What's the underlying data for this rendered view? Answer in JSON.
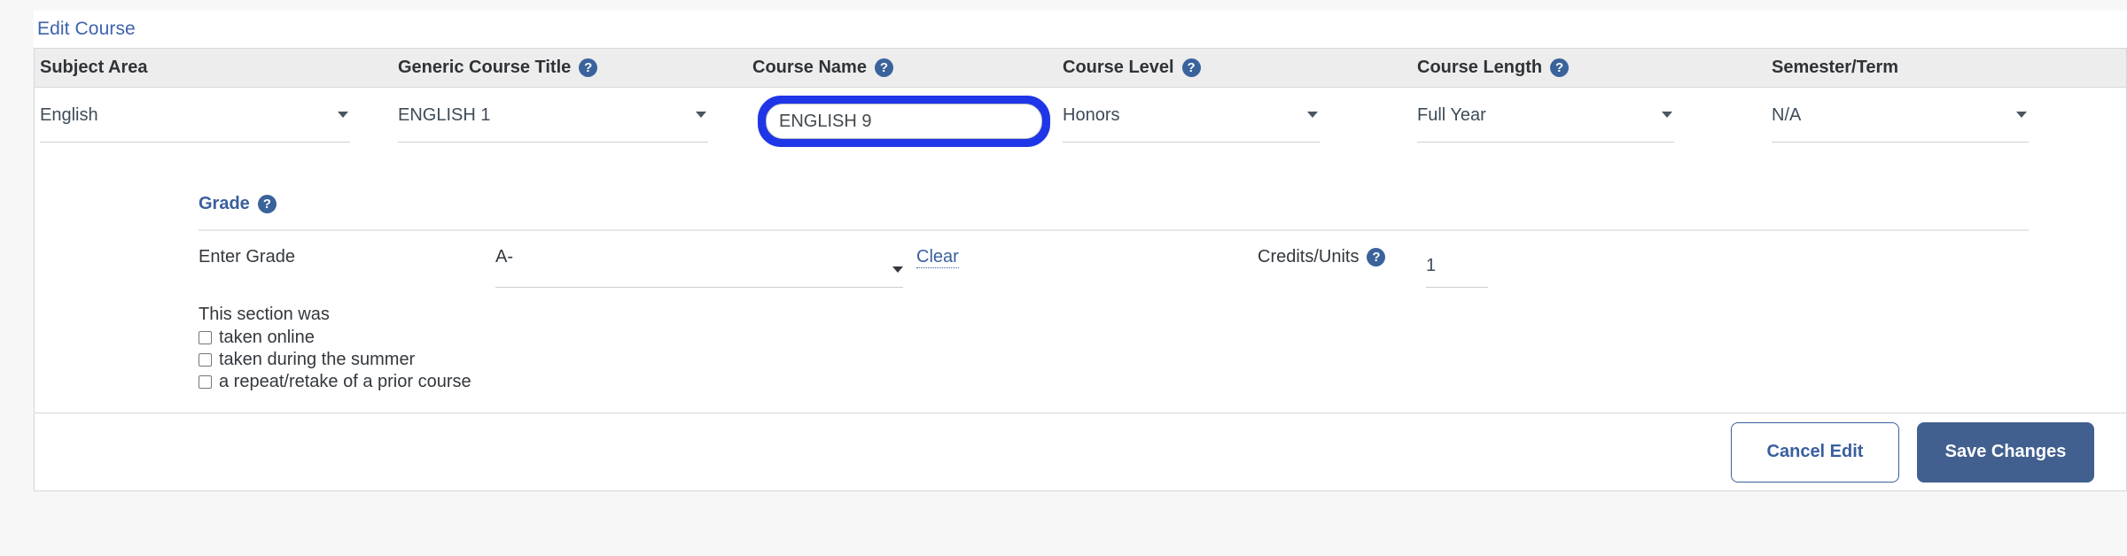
{
  "panel": {
    "title": "Edit Course",
    "help_icon": "help-circle-icon",
    "caret_icon": "chevron-down-icon"
  },
  "columns": [
    {
      "header": "Subject Area",
      "has_help": false,
      "value": "English",
      "type": "select"
    },
    {
      "header": "Generic Course Title",
      "has_help": true,
      "value": "ENGLISH 1",
      "type": "select"
    },
    {
      "header": "Course Name",
      "has_help": true,
      "value": "ENGLISH 9",
      "type": "text",
      "focused": true,
      "placeholder": ""
    },
    {
      "header": "Course Level",
      "has_help": true,
      "value": "Honors",
      "type": "select"
    },
    {
      "header": "Course Length",
      "has_help": true,
      "value": "Full Year",
      "type": "select"
    },
    {
      "header": "Semester/Term",
      "has_help": false,
      "value": "N/A",
      "type": "select"
    }
  ],
  "grade": {
    "section_title": "Grade",
    "enter_grade_label": "Enter Grade",
    "grade_value": "A-",
    "clear_label": "Clear",
    "credits_label": "Credits/Units",
    "credits_value": "1"
  },
  "section_flags": {
    "intro": "This section was",
    "options": [
      {
        "label": "taken online",
        "checked": false
      },
      {
        "label": "taken during the summer",
        "checked": false
      },
      {
        "label": "a repeat/retake of a prior course",
        "checked": false
      }
    ]
  },
  "footer": {
    "cancel_label": "Cancel Edit",
    "save_label": "Save Changes"
  },
  "colors": {
    "link_blue": "#3d63ad",
    "header_bg": "#ededed",
    "focus_ring": "#1f35e8",
    "primary_button": "#41608f",
    "help_icon": "#3a639c",
    "page_bg": "#f7f7f8"
  }
}
